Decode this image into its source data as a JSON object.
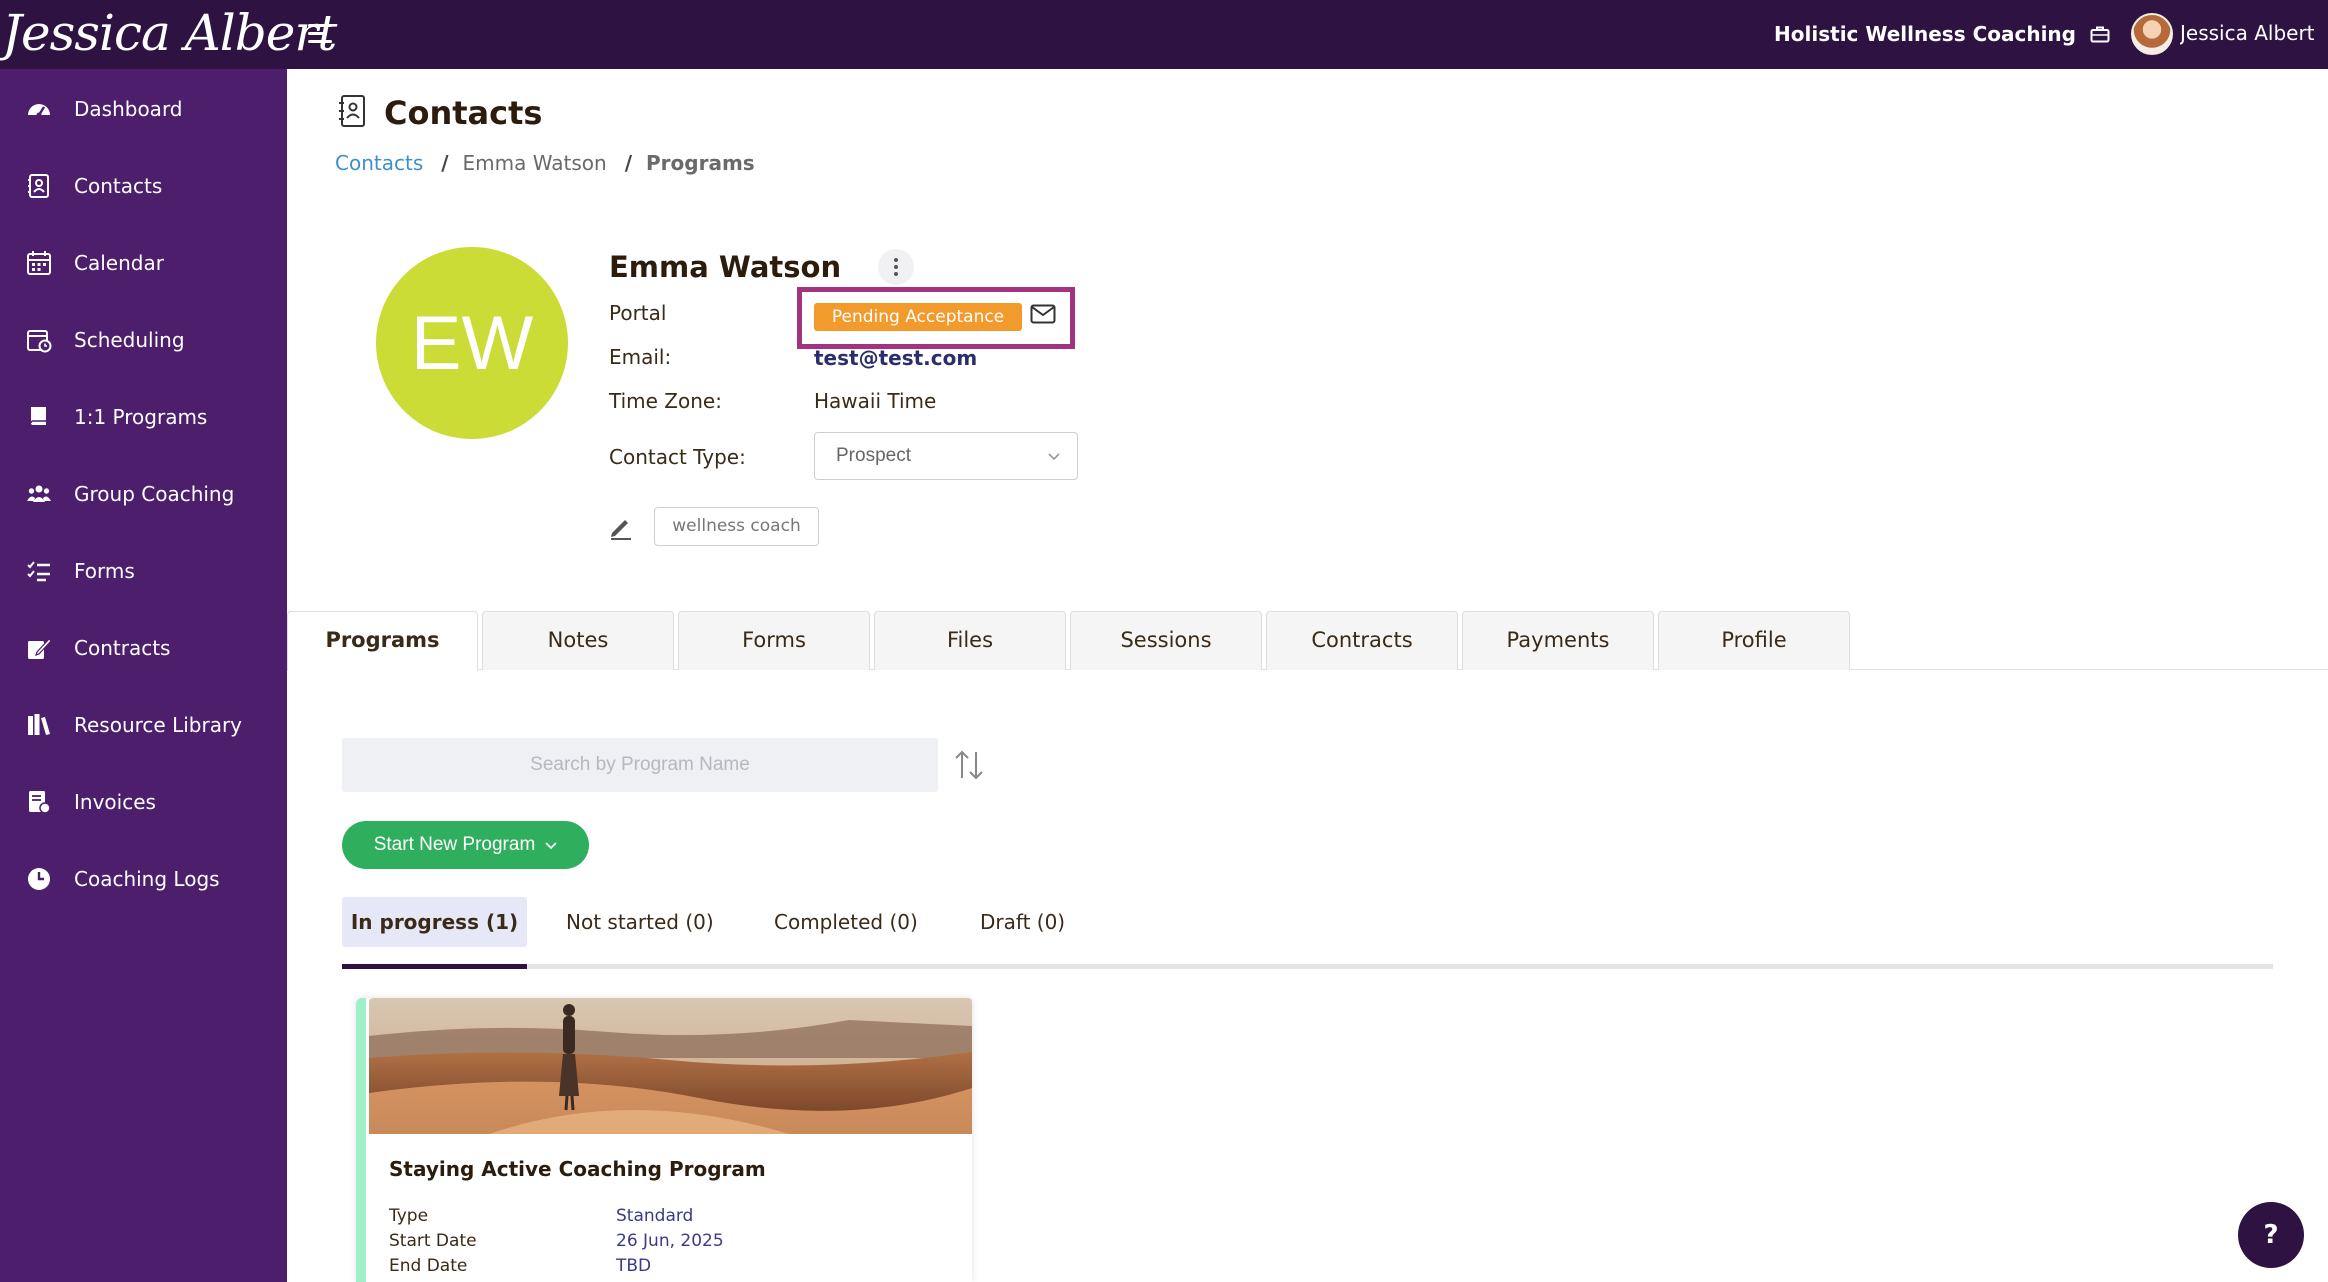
{
  "app": {
    "logo_text": "Jessica Albert",
    "business_name": "Holistic Wellness Coaching",
    "user_name": "Jessica Albert"
  },
  "sidebar": {
    "items": [
      {
        "label": "Dashboard",
        "icon": "dashboard-icon"
      },
      {
        "label": "Contacts",
        "icon": "contacts-icon"
      },
      {
        "label": "Calendar",
        "icon": "calendar-icon"
      },
      {
        "label": "Scheduling",
        "icon": "scheduling-icon"
      },
      {
        "label": "1:1 Programs",
        "icon": "book-icon"
      },
      {
        "label": "Group Coaching",
        "icon": "group-icon"
      },
      {
        "label": "Forms",
        "icon": "forms-icon"
      },
      {
        "label": "Contracts",
        "icon": "contract-sign-icon"
      },
      {
        "label": "Resource Library",
        "icon": "library-icon"
      },
      {
        "label": "Invoices",
        "icon": "invoice-icon"
      },
      {
        "label": "Coaching Logs",
        "icon": "clock-icon"
      }
    ]
  },
  "page": {
    "title": "Contacts",
    "breadcrumb": [
      "Contacts",
      "Emma Watson",
      "Programs"
    ]
  },
  "contact": {
    "initials": "EW",
    "name": "Emma Watson",
    "portal_label": "Portal",
    "portal_status": "Pending Acceptance",
    "email_label": "Email:",
    "email": "test@test.com",
    "timezone_label": "Time Zone:",
    "timezone": "Hawaii Time",
    "contact_type_label": "Contact Type:",
    "contact_type": "Prospect",
    "tag": "wellness coach"
  },
  "tabs": [
    "Programs",
    "Notes",
    "Forms",
    "Files",
    "Sessions",
    "Contracts",
    "Payments",
    "Profile"
  ],
  "programs": {
    "search_placeholder": "Search by Program Name",
    "start_button": "Start New Program",
    "subtabs": [
      "In progress (1)",
      "Not started (0)",
      "Completed (0)",
      "Draft (0)"
    ],
    "card": {
      "title": "Staying Active Coaching Program",
      "type_label": "Type",
      "type": "Standard",
      "start_label": "Start Date",
      "start": "26 Jun, 2025",
      "end_label": "End Date",
      "end": "TBD"
    }
  },
  "help_label": "?",
  "colors": {
    "topbar": "#2d1242",
    "sidebar": "#4c1e6b",
    "avatar": "#cadc35",
    "pending_badge": "#f39a2d",
    "highlight": "#a2347f",
    "start_button": "#2fae5e",
    "link": "#3f90c9"
  }
}
